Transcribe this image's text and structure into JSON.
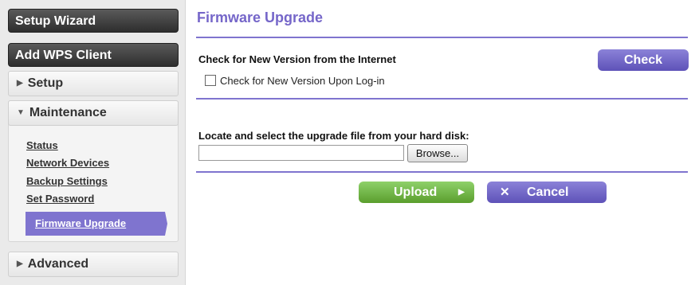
{
  "sidebar": {
    "setup_wizard": "Setup Wizard",
    "add_wps_client": "Add WPS Client",
    "setup": "Setup",
    "maintenance": "Maintenance",
    "maintenance_items": [
      "Status",
      "Network Devices",
      "Backup Settings",
      "Set Password"
    ],
    "firmware_upgrade": "Firmware Upgrade",
    "advanced": "Advanced"
  },
  "main": {
    "title": "Firmware Upgrade",
    "check_heading": "Check for New Version from the Internet",
    "check_button": "Check",
    "checkbox_label": "Check for New Version Upon Log-in",
    "checkbox_checked": false,
    "locate_label": "Locate and select the upgrade file from your hard disk:",
    "file_value": "",
    "browse_button": "Browse...",
    "upload_button": "Upload",
    "cancel_button": "Cancel"
  },
  "colors": {
    "accent": "#7f74cf",
    "upload": "#6fb83f"
  }
}
